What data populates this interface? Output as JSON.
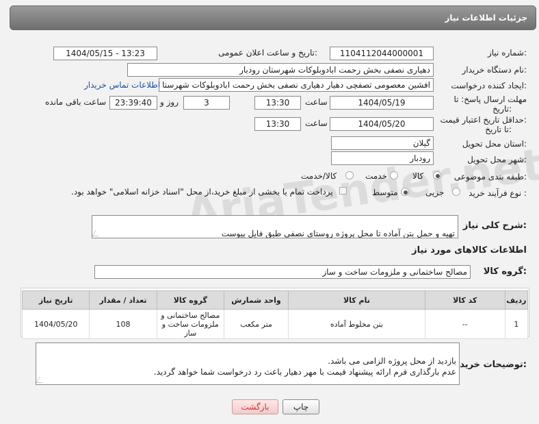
{
  "header": {
    "title": "جزئیات اطلاعات نیاز"
  },
  "form": {
    "need_number_label": "شماره نیاز:",
    "need_number": "1104112044000001",
    "announce_label": "تاریخ و ساعت اعلان عمومی:",
    "announce_value": "1404/05/15 - 13:23",
    "buyer_label": "نام دستگاه خریدار:",
    "buyer_value": "دهیاری نصفی بخش رحمت ابادوبلوکات شهرستان رودبار",
    "creator_label": "ایجاد کننده درخواست:",
    "creator_value": "افشین معصومی تصفچی دهیار دهیاری نصفی بخش رحمت ابادوبلوکات شهرستا",
    "contact_link": "اطلاعات تماس خریدار",
    "deadline_label_1": "مهلت ارسال پاسخ: تا",
    "deadline_label_2": "تاریخ:",
    "deadline_date": "1404/05/19",
    "time_label": "ساعت",
    "deadline_time": "13:30",
    "day_label": "روز و",
    "days_value": "3",
    "remaining_time": "23:39:40",
    "remaining_label": "ساعت باقی مانده",
    "min_price_label_1": "حداقل تاریخ اعتبار قیمت:",
    "min_price_label_2": "تا تاریخ:",
    "price_date": "1404/05/20",
    "price_time": "13:30",
    "province_label": "استان محل تحویل:",
    "province_value": "گیلان",
    "city_label": "شهر محل تحویل:",
    "city_value": "رودبار",
    "category_label": "طبقه بندی موضوعی:",
    "category_options": [
      "کالا",
      "خدمت",
      "کالا/خدمت"
    ],
    "category_selected": "کالا",
    "process_label": "نوع فرآیند خرید :",
    "process_options": [
      "جزیی",
      "متوسط"
    ],
    "process_selected": "متوسط",
    "payment_note": "پرداخت تمام یا بخشی از مبلغ خرید،از محل \"اسناد خزانه اسلامی\" خواهد بود."
  },
  "description": {
    "label": "شرح کلی نیاز:",
    "value": "تهیه و حمل بتن آماده تا محل پروژه روستای نصفی طبق فایل پیوست"
  },
  "goods": {
    "section_title": "اطلاعات کالاهای مورد نیاز",
    "group_label": "گروه کالا:",
    "group_value": "مصالح ساختمانی و ملزومات ساخت و ساز",
    "columns": [
      "ردیف",
      "کد کالا",
      "نام کالا",
      "واحد شمارش",
      "گروه کالا",
      "تعداد / مقدار",
      "تاریخ نیاز"
    ],
    "rows": [
      [
        "1",
        "--",
        "بتن مخلوط آماده",
        "متر مکعب",
        "مصالح ساختمانی و ملزومات ساخت و ساز",
        "108",
        "1404/05/20"
      ]
    ]
  },
  "buyer_notes": {
    "label": "توضیحات خریدار:",
    "value": "بازدید از محل پروژه الزامی می باشد.\nعدم بارگذاری فرم ارائه پیشنهاد قیمت با مهر دهیار باعث رد درخواست شما خواهد گردید."
  },
  "watermark": "AriaTender.net",
  "buttons": {
    "print": "چاپ",
    "back": "بازگشت"
  }
}
